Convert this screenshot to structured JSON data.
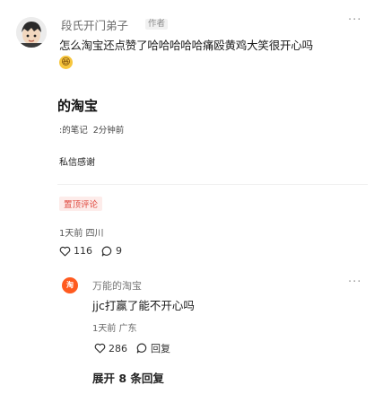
{
  "comment": {
    "username": "段氏开门弟子",
    "author_tag": "作者",
    "more": "···",
    "text": "怎么淘宝还点赞了哈哈哈哈哈痛殴黄鸡大笑很开心吗",
    "emoji": "😆"
  },
  "post": {
    "title": "的淘宝",
    "meta_source": ":的笔记",
    "meta_time": "2分钟前",
    "private_thanks": "私信感谢"
  },
  "pinned_comment": {
    "pin_label": "置顶评论",
    "time_location": "1天前 四川",
    "likes": "116",
    "replies": "9"
  },
  "reply": {
    "avatar_text": "淘",
    "username": "万能的淘宝",
    "more": "···",
    "text": "jjc打赢了能不开心吗",
    "time_location": "1天前 广东",
    "likes": "286",
    "reply_label": "回复"
  },
  "expand_label": "展开 8 条回复"
}
